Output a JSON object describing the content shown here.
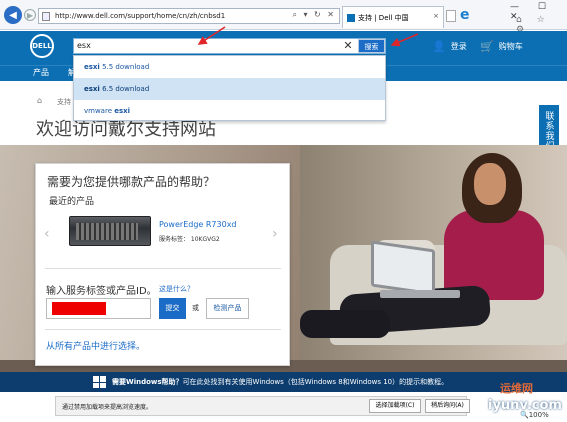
{
  "browser": {
    "url": "http://www.dell.com/support/home/cn/zh/cnbsd1",
    "address_actions": "⌕ ▾ ↻ ✕",
    "tab_title": "支持 | Dell 中国",
    "tab_close": "×",
    "window_buttons": "— ☐ ✕",
    "tools_icons": "⌂ ☆ ⚙"
  },
  "header": {
    "logo_text": "DELL",
    "search_value": "esx",
    "search_clear": "✕",
    "search_button": "搜索",
    "login_label": "登录",
    "cart_label": "购物车"
  },
  "nav": {
    "products": "产品",
    "item2": "解"
  },
  "suggestions": [
    {
      "bold": "esxi",
      "rest": " 5.5 download"
    },
    {
      "bold": "esxi",
      "rest": " 6.5 download"
    },
    {
      "bold": "vmware ",
      "rest": "esxi"
    }
  ],
  "page": {
    "breadcrumb_home": "⌂",
    "breadcrumb_text": "支持",
    "title": "欢迎访问戴尔支持网站",
    "contact_tab": "联系我们"
  },
  "card": {
    "title": "需要为您提供哪款产品的帮助？",
    "recent_label": "最近的产品",
    "prev": "‹",
    "next": "›",
    "product_name": "PowerEdge R730xd",
    "service_tag": "服务标签： 10KGVG2",
    "input_label": "输入服务标签或产品ID。",
    "what_link": "这是什么？",
    "submit": "提交",
    "or": "或",
    "detect": "检测产品",
    "choose_link": "从所有产品中进行选择。"
  },
  "banner": {
    "bold_text": "需要Windows帮助？",
    "text": "可在此处找到有关使用Windows（包括Windows 8和Windows 10）的提示和教程。"
  },
  "notification": {
    "text": "通过禁用加载项来提高浏览速度。",
    "button1": "选择加载项(C)",
    "button2": "稍后询问(A)"
  },
  "status": {
    "zoom": "🔍100%"
  },
  "watermark": {
    "line1": "运维网",
    "line2": "iyunv.com"
  },
  "colors": {
    "dell_blue": "#0c6fb3",
    "annotation_arrow": "#e0262b",
    "redaction": "#ee0000"
  }
}
